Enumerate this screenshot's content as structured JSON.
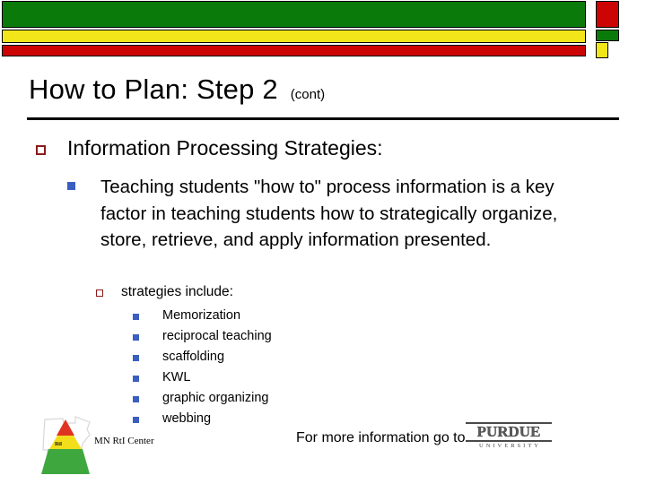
{
  "slide": {
    "title": "How to Plan:  Step 2",
    "title_suffix": "(cont)"
  },
  "content": {
    "level1": {
      "bullet_icon": "open-square-bullet-icon",
      "text": "Information Processing Strategies:"
    },
    "level2": {
      "bullet_icon": "filled-square-bullet-icon",
      "text": "Teaching students \"how to\" process information is a key factor in teaching students how to strategically organize, store, retrieve, and apply information presented."
    },
    "level3": {
      "bullet_icon": "open-square-bullet-icon",
      "text": "strategies include:"
    },
    "level4": {
      "bullet_icon": "filled-square-bullet-icon",
      "items": [
        "Memorization",
        "reciprocal teaching",
        "scaffolding",
        "KWL",
        "graphic organizing",
        "webbing"
      ]
    }
  },
  "footer": {
    "mn_logo": {
      "pyramid_label": "RtI",
      "caption": "MN RtI Center"
    },
    "more_info_text": "For more information go to",
    "purdue": {
      "wordmark": "PURDUE",
      "subtitle": "UNIVERSITY"
    }
  },
  "colors": {
    "banner_green": "#0A7A0A",
    "banner_yellow": "#F2E61B",
    "banner_red": "#CC0404",
    "bullet_open": "#8C1A1A",
    "bullet_filled": "#3B5FC0",
    "pyramid_top": "#E03423",
    "pyramid_middle": "#F2DE1B",
    "pyramid_bottom": "#3EA83E"
  }
}
